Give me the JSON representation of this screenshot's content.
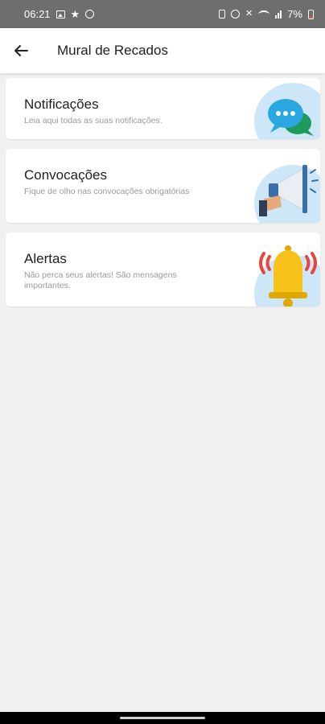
{
  "status_bar": {
    "time": "06:21",
    "battery_percent": "7%",
    "icons_left": [
      "image-icon",
      "star-icon",
      "whatsapp-icon"
    ],
    "icons_right": [
      "battery-saver-icon",
      "alarm-icon",
      "mute-icon",
      "wifi-icon",
      "signal-icon",
      "battery-icon"
    ]
  },
  "header": {
    "title": "Mural de Recados",
    "back_icon": "arrow-left-icon"
  },
  "cards": [
    {
      "title": "Notificações",
      "description": "Leia aqui todas as suas notificações.",
      "icon": "chat-bubbles-icon"
    },
    {
      "title": "Convocações",
      "description": "Fique de olho nas convocações obrigatórias",
      "icon": "megaphone-icon"
    },
    {
      "title": "Alertas",
      "description": "Não perca seus alertas! São mensagens importantes.",
      "icon": "bell-icon"
    }
  ],
  "colors": {
    "background": "#f0f0f0",
    "card": "#ffffff",
    "illustration_circle": "#cde7f8",
    "status_bar": "#6e6e6e",
    "bell": "#f7c21a",
    "alert_waves": "#e8453c",
    "chat_bubble_blue": "#2aa7e0",
    "chat_bubble_green": "#1d9a5c"
  }
}
